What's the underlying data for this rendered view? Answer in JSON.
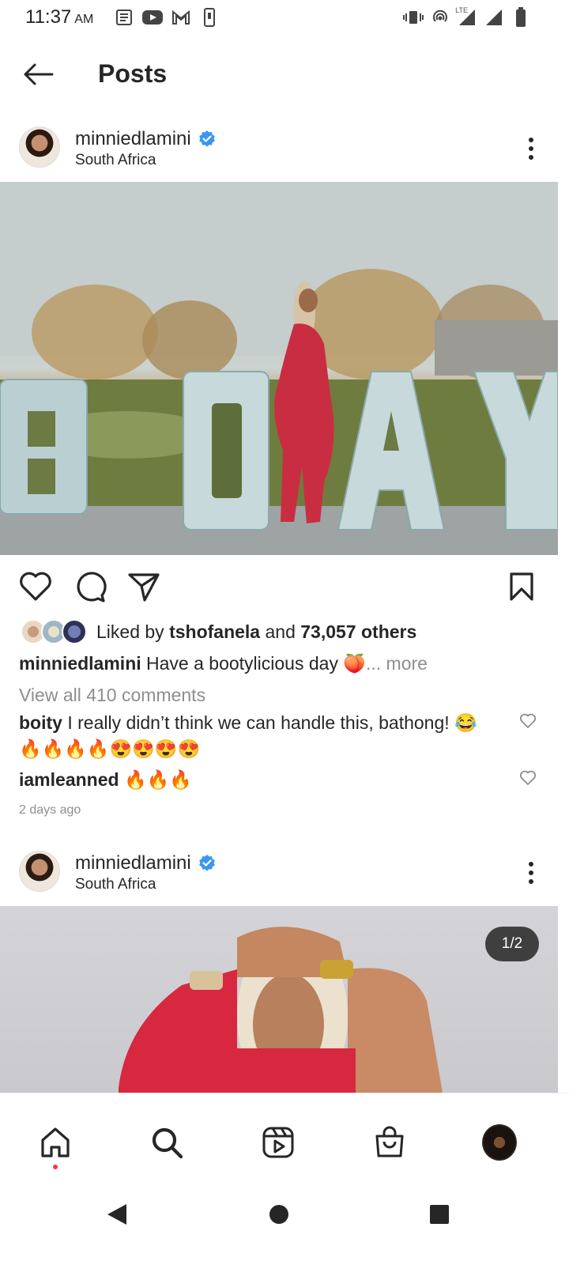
{
  "status_bar": {
    "time": "11:37",
    "ampm": "AM",
    "network": "LTE"
  },
  "header": {
    "title": "Posts"
  },
  "post1": {
    "author": "minniedlamini",
    "location": "South Africa",
    "likes_prefix": "Liked by",
    "liked_by": "tshofanela",
    "likes_conj": "and",
    "likes_others": "73,057 others",
    "caption_user": "minniedlamini",
    "caption_text": "Have a bootylicious day 🍑",
    "caption_more": "... more",
    "view_comments": "View all 410 comments",
    "comments": [
      {
        "user": "boity",
        "text": "I really didn’t think we can handle this, bathong! 😂 🔥🔥🔥🔥😍😍😍😍"
      },
      {
        "user": "iamleanned",
        "text": "🔥🔥🔥"
      }
    ],
    "timestamp": "2 days ago",
    "image_letters": "BDAY"
  },
  "post2": {
    "author": "minniedlamini",
    "location": "South Africa",
    "page_indicator": "1/2"
  },
  "colors": {
    "verified": "#3897f0",
    "text": "#262626",
    "muted": "#8e8e8e",
    "notification_dot": "#ff3040"
  },
  "icons": {
    "back": "arrow-left-icon",
    "like": "heart-icon",
    "comment": "speech-bubble-icon",
    "share": "paper-plane-icon",
    "save": "bookmark-icon",
    "home": "home-icon",
    "search": "search-icon",
    "reels": "reels-icon",
    "shop": "shopping-bag-icon"
  }
}
